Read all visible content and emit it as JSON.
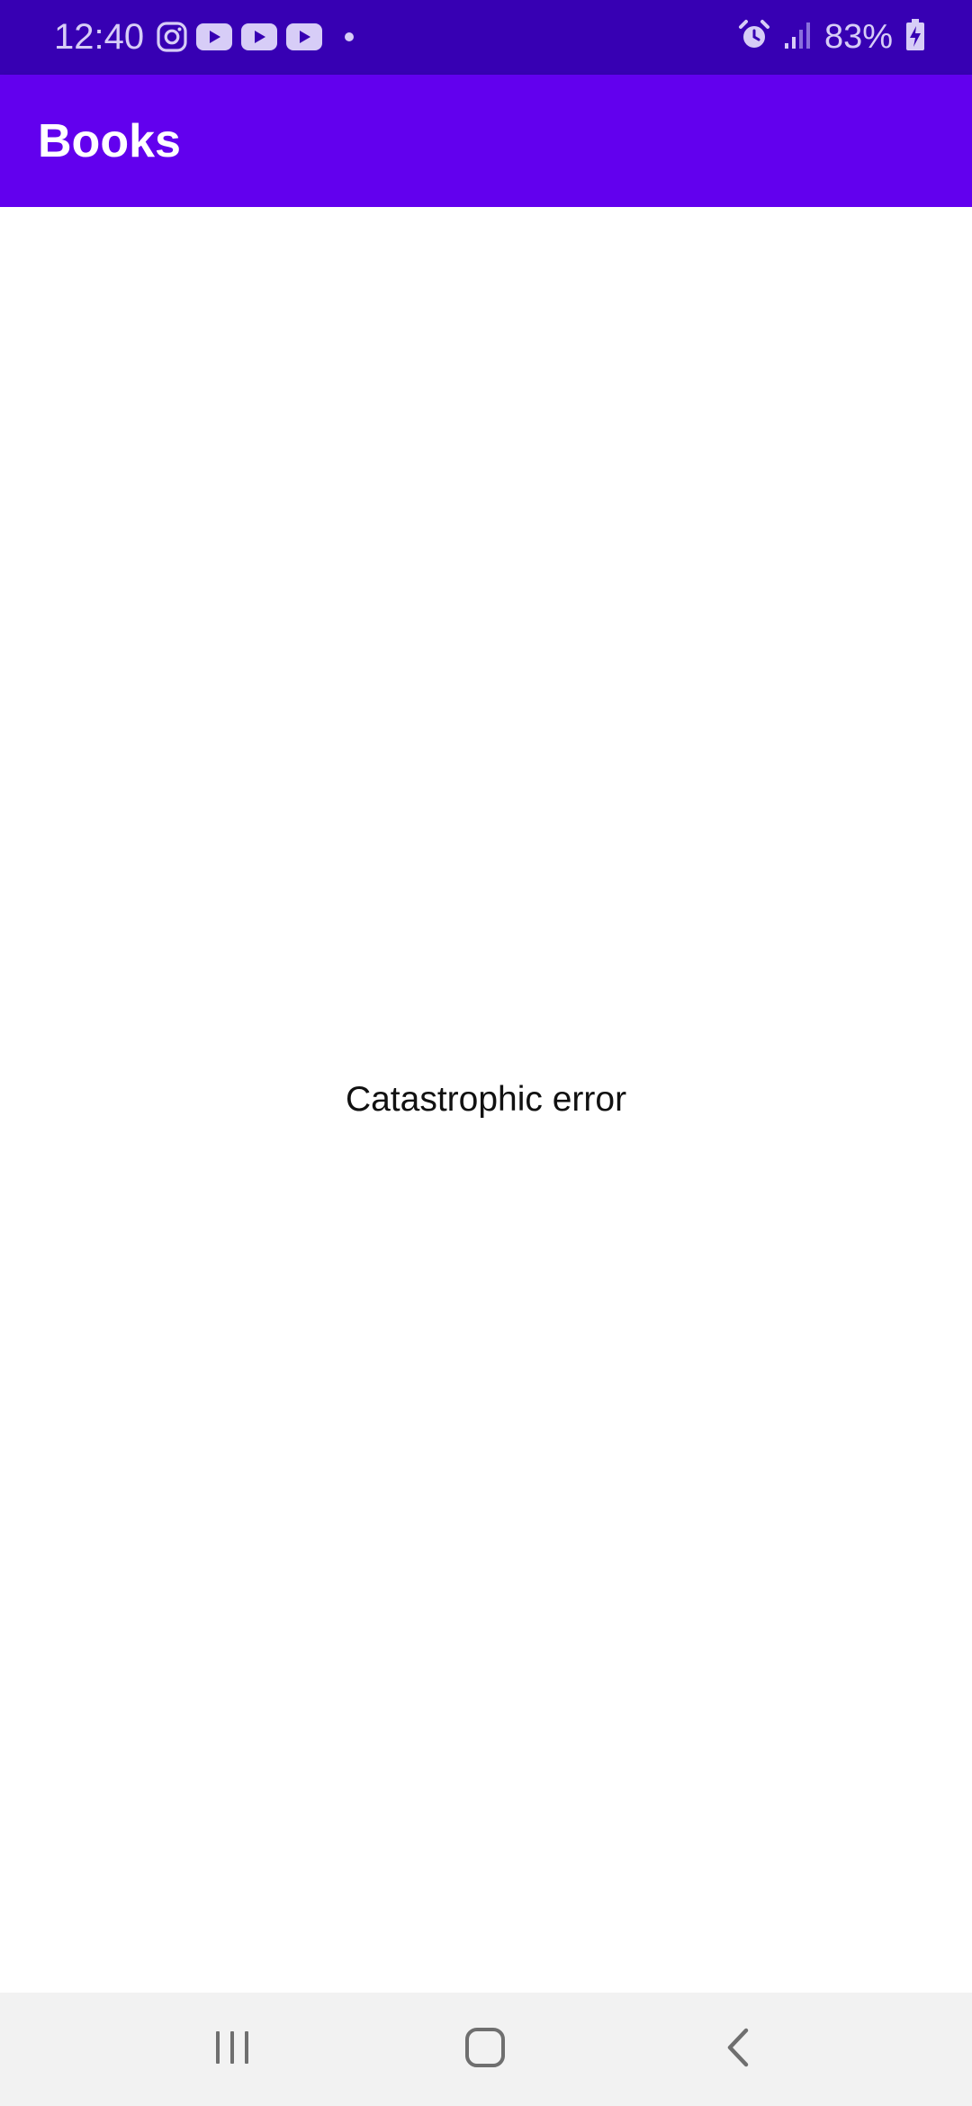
{
  "status_bar": {
    "time": "12:40",
    "battery_percent": "83%",
    "notification_icons": [
      "instagram-icon",
      "youtube-icon",
      "youtube-icon",
      "youtube-icon",
      "more-notifications-dot-icon"
    ],
    "system_icons": [
      "alarm-icon",
      "signal-icon",
      "battery-charging-icon"
    ]
  },
  "app_bar": {
    "title": "Books"
  },
  "main": {
    "message": "Catastrophic error"
  },
  "nav_bar": {
    "buttons": [
      "recents-icon",
      "home-icon",
      "back-icon"
    ]
  },
  "colors": {
    "status_bar": "#3700b3",
    "app_bar": "#6200ee",
    "background": "#ffffff",
    "nav_bar": "#f2f2f2"
  }
}
